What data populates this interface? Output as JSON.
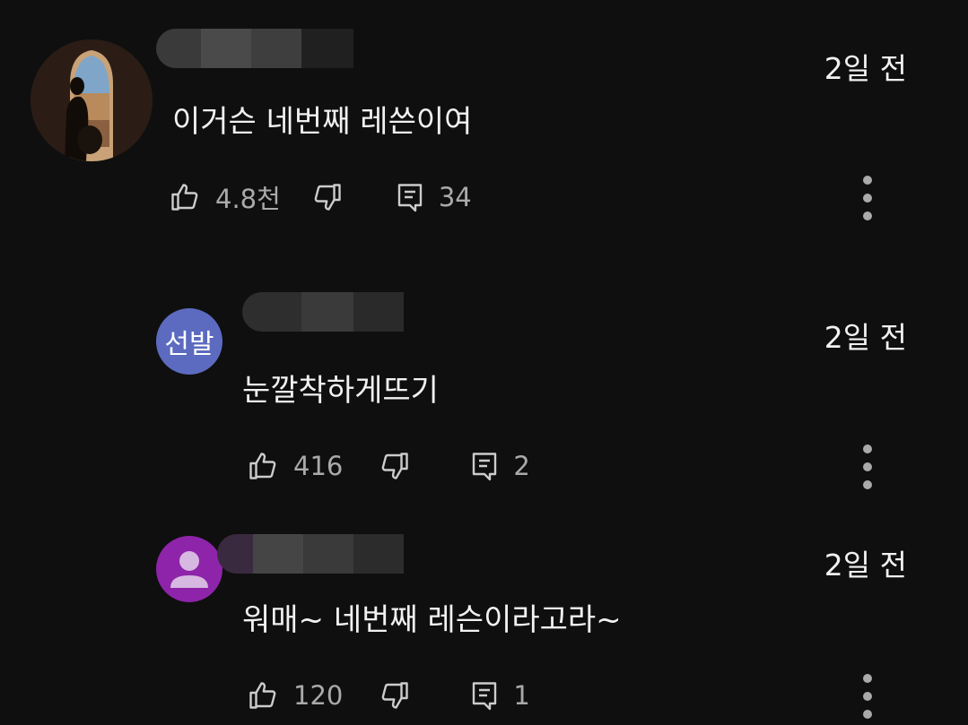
{
  "comments": [
    {
      "author": "",
      "time": "2일 전",
      "text": "이거슨 네번째 레쓴이여",
      "likes": "4.8천",
      "replies": "34"
    },
    {
      "author": "",
      "avatar_text": "선발",
      "time": "2일 전",
      "text": "눈깔착하게뜨기",
      "likes": "416",
      "replies": "2"
    },
    {
      "author": "",
      "time": "2일 전",
      "text": "워매~  네번째 레슨이라고라~",
      "likes": "120",
      "replies": "1"
    }
  ],
  "icons": {
    "like": "thumb-up-icon",
    "dislike": "thumb-down-icon",
    "reply": "reply-icon",
    "more": "more-vertical-icon"
  },
  "colors": {
    "background": "#0f0f0f",
    "text": "#f1f1f1",
    "secondary": "#aaaaaa",
    "avatar_indigo": "#5c6bc0",
    "avatar_purple": "#8e24aa"
  }
}
